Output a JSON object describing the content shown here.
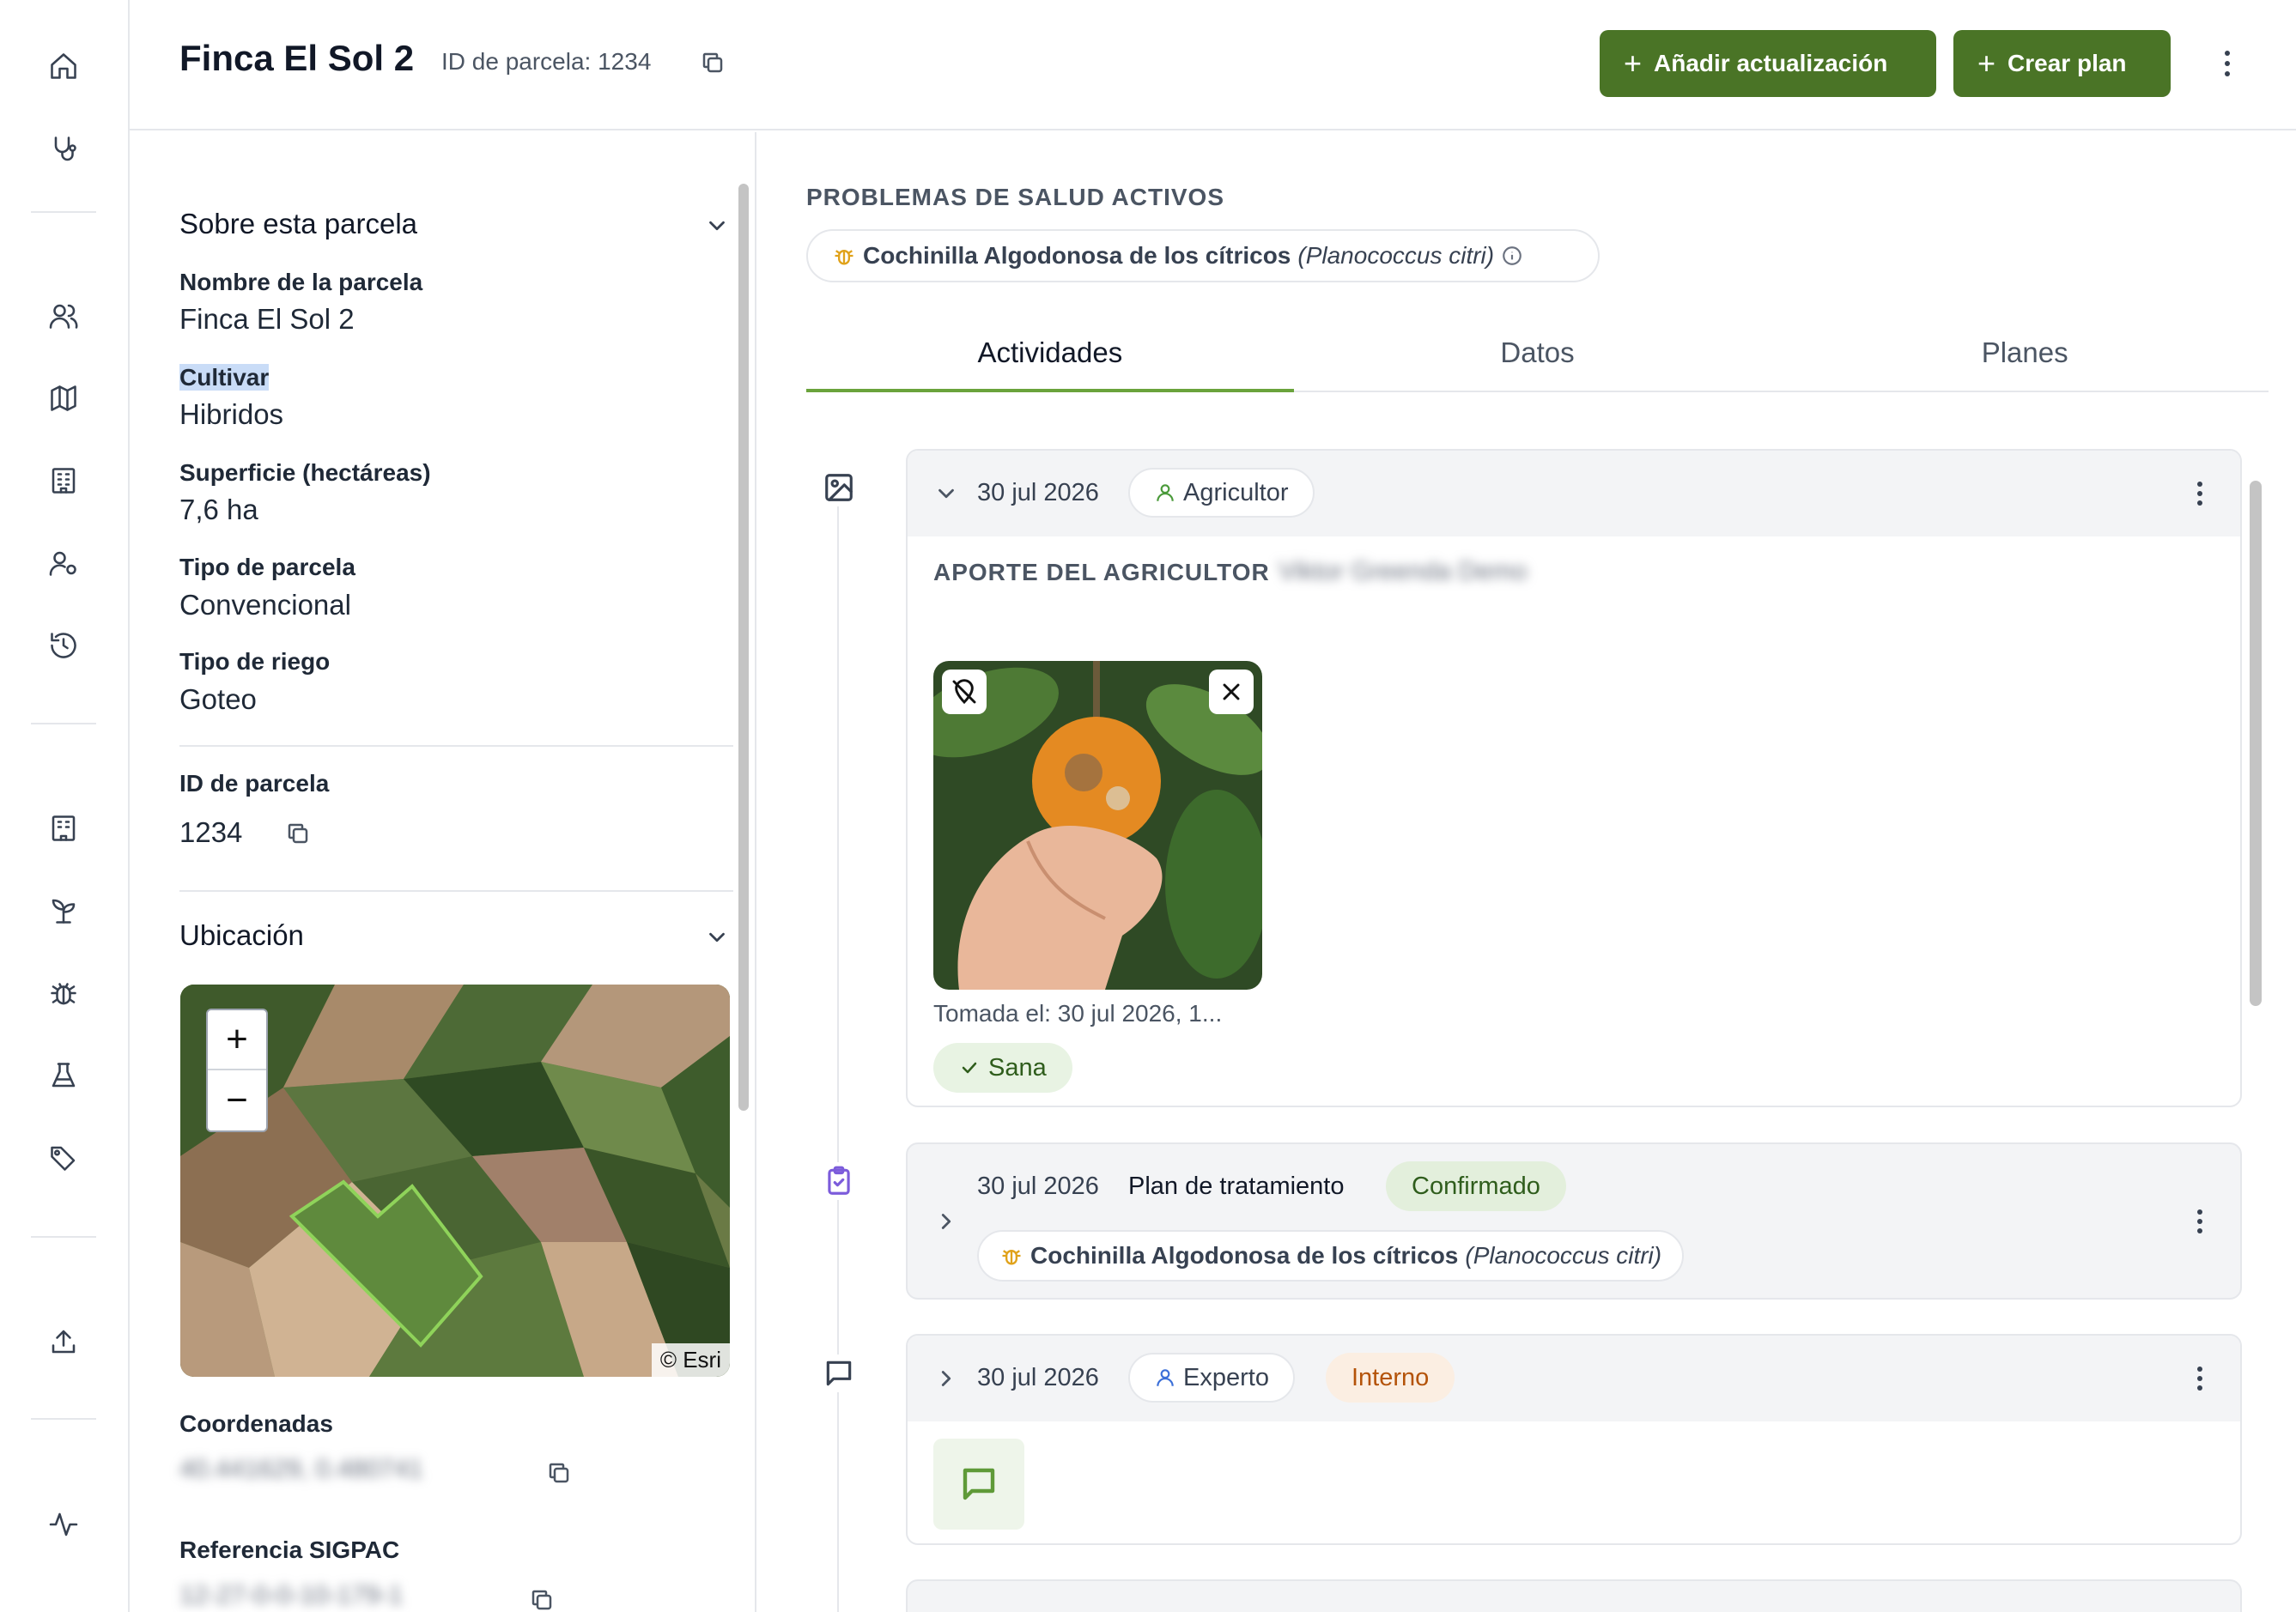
{
  "header": {
    "title": "Finca El Sol 2",
    "parcel_id": "ID de parcela: 1234",
    "add_update_label": "Añadir actualización",
    "create_plan_label": "Crear plan"
  },
  "rail": {
    "icons": [
      "home-icon",
      "stethoscope-icon",
      "users-icon",
      "map-icon",
      "building-icon",
      "user-settings-icon",
      "history-icon",
      "building-icon",
      "sprout-icon",
      "bug-icon",
      "flask-icon",
      "tags-icon",
      "upload-icon",
      "activity-icon"
    ]
  },
  "about": {
    "section_title": "Sobre esta parcela",
    "fields": [
      {
        "label": "Nombre de la parcela",
        "value": "Finca El Sol 2"
      },
      {
        "label": "Cultivar",
        "value": "Hibridos"
      },
      {
        "label": "Superficie (hectáreas)",
        "value": "7,6 ha"
      },
      {
        "label": "Tipo de parcela",
        "value": "Convencional"
      },
      {
        "label": "Tipo de riego",
        "value": "Goteo"
      }
    ],
    "id_label": "ID de parcela",
    "id_value": "1234"
  },
  "location": {
    "section_title": "Ubicación",
    "zoom_in": "+",
    "zoom_out": "−",
    "attribution": "© Esri",
    "coordinates_label": "Coordenadas",
    "coordinates_value": "40.441629, 0.480741",
    "sigpac_label": "Referencia SIGPAC",
    "sigpac_value": "12-27-0-0-10-179-1"
  },
  "health": {
    "title": "PROBLEMAS DE SALUD ACTIVOS",
    "issue_name": "Cochinilla Algodonosa de los cítricos",
    "issue_latin": "(Planococcus citri)"
  },
  "tabs": [
    {
      "label": "Actividades",
      "active": true
    },
    {
      "label": "Datos",
      "active": false
    },
    {
      "label": "Planes",
      "active": false
    }
  ],
  "activities": [
    {
      "date": "30 jul 2026",
      "role": "Agricultor",
      "contrib_title": "APORTE DEL AGRICULTOR",
      "contrib_name": "Viktor Greenda Demo",
      "photo_caption": "Tomada el: 30 jul 2026, 1...",
      "status": "Sana"
    },
    {
      "date": "30 jul 2026",
      "type": "Plan de tratamiento",
      "status": "Confirmado",
      "issue_name": "Cochinilla Algodonosa de los cítricos",
      "issue_latin": "(Planococcus citri)"
    },
    {
      "date": "30 jul 2026",
      "role": "Experto",
      "status": "Interno"
    }
  ],
  "colors": {
    "brand_green": "#4a7426",
    "tab_underline": "#6aa33c",
    "confirmed_bg": "#e8f3e3",
    "internal_bg": "#fbeee2",
    "internal_text": "#b45309",
    "plan_icon": "#7c5cdb",
    "bug_icon": "#e0a21a"
  }
}
